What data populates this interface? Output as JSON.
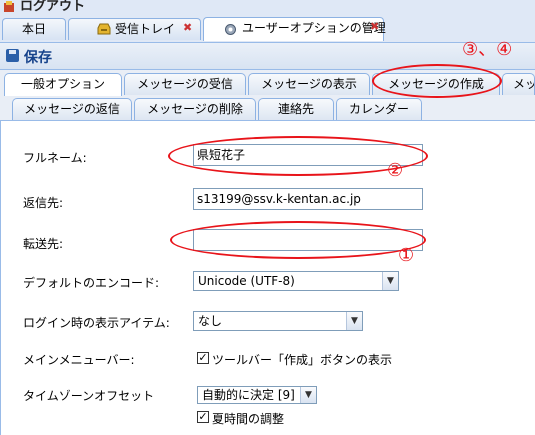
{
  "app": {
    "title": "ログアウト"
  },
  "window_tabs": [
    {
      "label": "本日"
    },
    {
      "label": "受信トレイ"
    },
    {
      "label": "ユーザーオプションの管理"
    }
  ],
  "toolbar": {
    "save_label": "保存"
  },
  "option_tabs_row1": [
    {
      "label": "一般オプション"
    },
    {
      "label": "メッセージの受信"
    },
    {
      "label": "メッセージの表示"
    },
    {
      "label": "メッセージの作成"
    },
    {
      "label": "メッ"
    }
  ],
  "option_tabs_row2": [
    {
      "label": "メッセージの返信"
    },
    {
      "label": "メッセージの削除"
    },
    {
      "label": "連絡先"
    },
    {
      "label": "カレンダー"
    }
  ],
  "form": {
    "fullname": {
      "label": "フルネーム:",
      "value": "県短花子"
    },
    "reply_to": {
      "label": "返信先:",
      "value": "s13199@ssv.k-kentan.ac.jp"
    },
    "forward_to": {
      "label": "転送先:",
      "value": ""
    },
    "encoding": {
      "label": "デフォルトのエンコード:",
      "value": "Unicode (UTF-8)"
    },
    "login_item": {
      "label": "ログイン時の表示アイテム:",
      "value": "なし"
    },
    "main_menu_bar": {
      "label": "メインメニューバー:",
      "checkbox_label": "ツールバー「作成」ボタンの表示",
      "checked": true
    },
    "timezone": {
      "label": "タイムゾーンオフセット",
      "value": "自動的に決定 [9]"
    },
    "dst": {
      "label": "夏時間の調整",
      "checked": true
    }
  },
  "annotations": {
    "n1": "①",
    "n2": "②",
    "n34": "③、④",
    "color": "#e8141a"
  }
}
